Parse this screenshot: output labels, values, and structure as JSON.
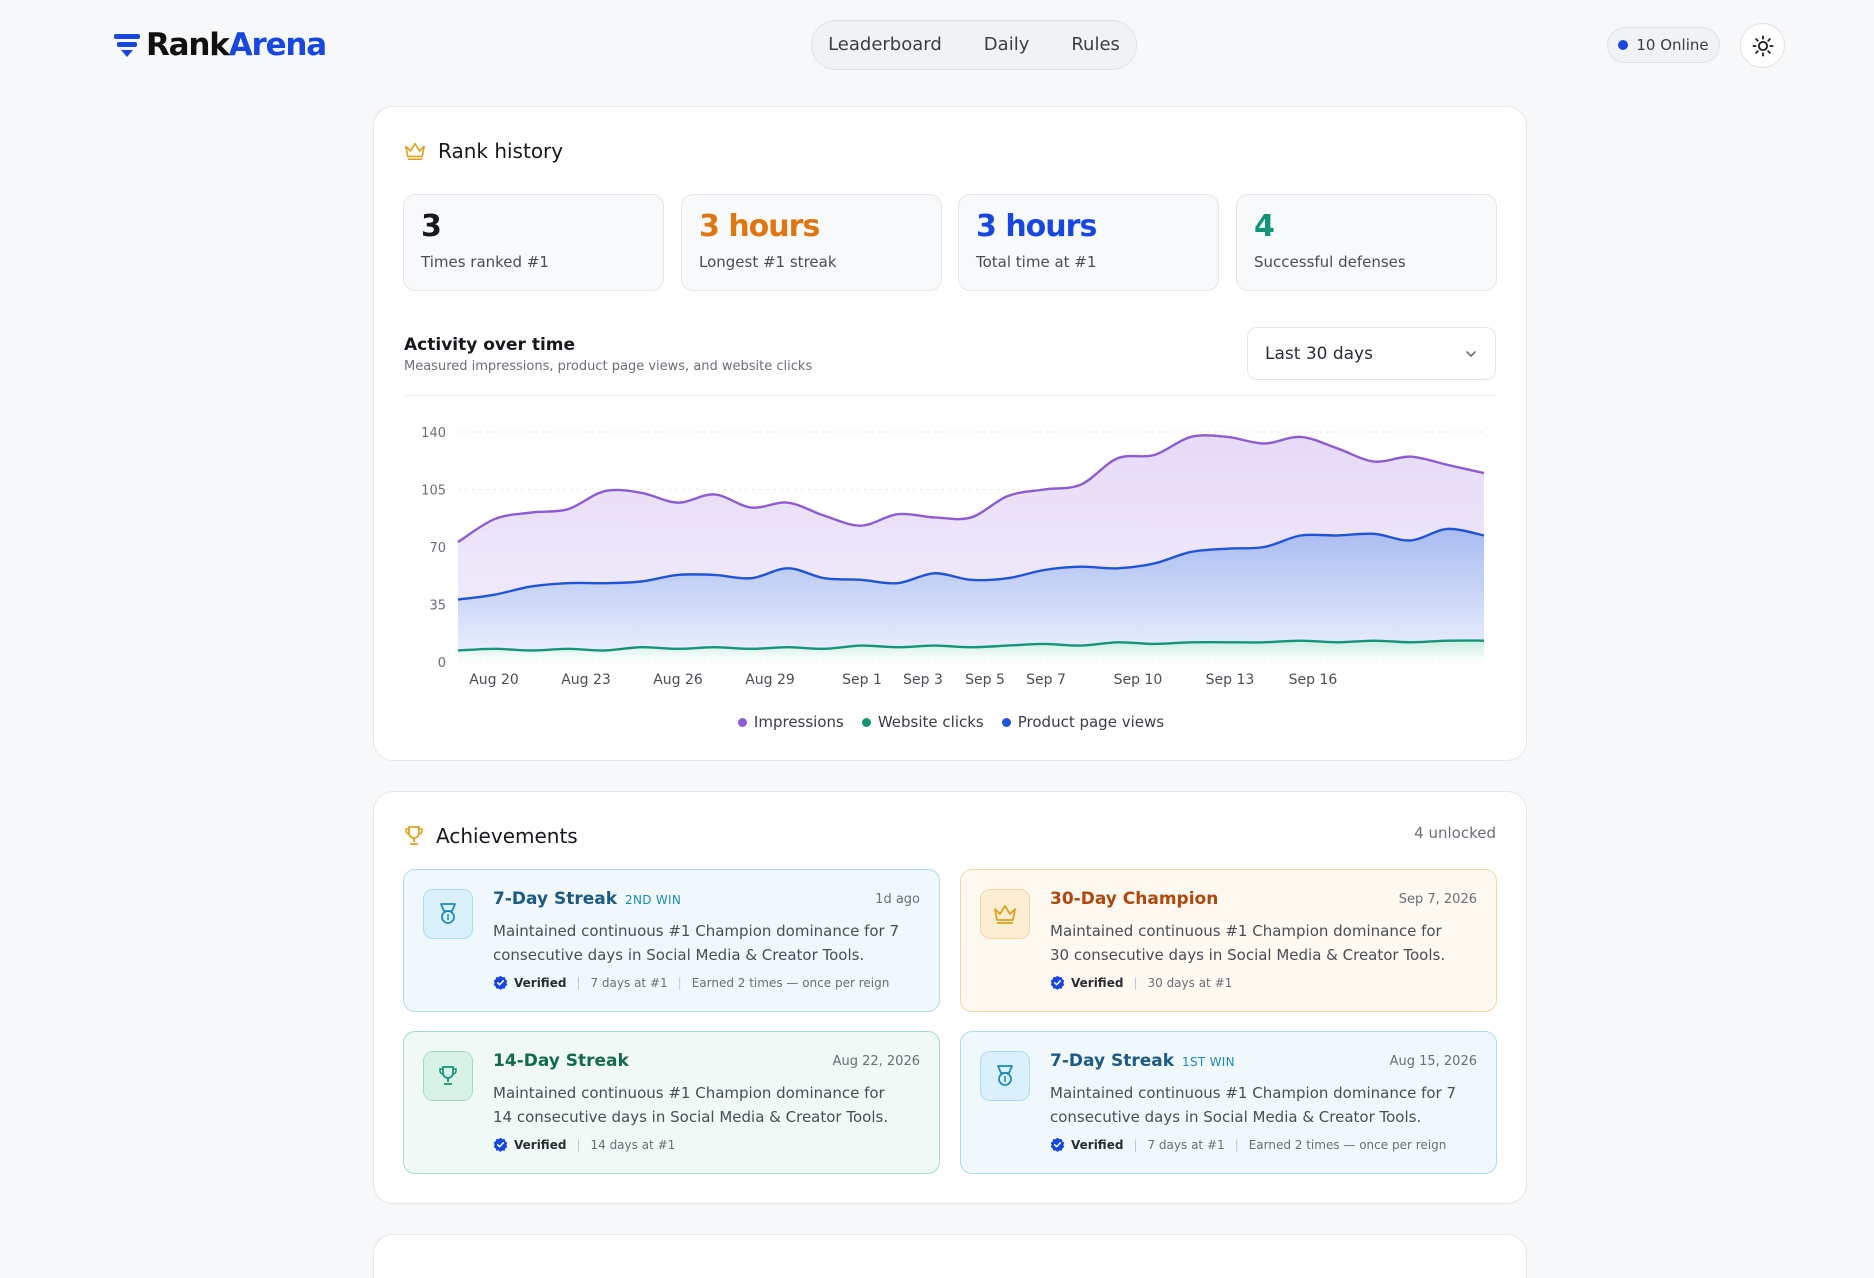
{
  "header": {
    "brand_part1": "Rank",
    "brand_part2": "Arena",
    "nav": [
      "Leaderboard",
      "Daily",
      "Rules"
    ],
    "online": "10 Online"
  },
  "rank_history": {
    "title": "Rank history",
    "stats": [
      {
        "value": "3",
        "label": "Times ranked #1",
        "color": "#16181d"
      },
      {
        "value": "3 hours",
        "label": "Longest #1 streak",
        "color": "#e07611"
      },
      {
        "value": "3 hours",
        "label": "Total time at #1",
        "color": "#1746e0"
      },
      {
        "value": "4",
        "label": "Successful defenses",
        "color": "#11957a"
      }
    ],
    "activity_title": "Activity over time",
    "activity_subtitle": "Measured impressions, product page views, and website clicks",
    "range_selected": "Last 30 days"
  },
  "chart_data": {
    "type": "area",
    "x_tick_labels": [
      "Aug 20",
      "Aug 23",
      "Aug 26",
      "Aug 29",
      "Sep 1",
      "Sep 3",
      "Sep 5",
      "Sep 7",
      "Sep 10",
      "Sep 13",
      "Sep 16"
    ],
    "y_ticks": [
      0,
      35,
      70,
      105,
      140
    ],
    "ylim": [
      0,
      140
    ],
    "grid": "horizontal dashed",
    "legend_position": "bottom-center",
    "series": [
      {
        "name": "Impressions",
        "color": "#8e5bd4",
        "fill": "#ece3f8",
        "values": [
          73,
          87,
          91,
          93,
          104,
          103,
          97,
          102,
          94,
          97,
          89,
          83,
          90,
          88,
          88,
          101,
          105,
          108,
          124,
          126,
          137,
          137,
          133,
          137,
          130,
          122,
          125,
          120,
          115
        ]
      },
      {
        "name": "Product page views",
        "color": "#1f54d8",
        "fill": "#c6d2f6",
        "values": [
          38,
          41,
          46,
          48,
          48,
          49,
          53,
          53,
          51,
          57,
          51,
          50,
          48,
          54,
          50,
          51,
          56,
          58,
          57,
          60,
          67,
          69,
          70,
          77,
          77,
          78,
          74,
          81,
          77
        ]
      },
      {
        "name": "Website clicks",
        "color": "#14957a",
        "fill": "#daf1ea",
        "values": [
          7,
          8,
          7,
          8,
          7,
          9,
          8,
          9,
          8,
          9,
          8,
          10,
          9,
          10,
          9,
          10,
          11,
          10,
          12,
          11,
          12,
          12,
          12,
          13,
          12,
          13,
          12,
          13,
          13
        ]
      }
    ]
  },
  "achievements": {
    "title": "Achievements",
    "unlocked": "4 unlocked",
    "items": [
      {
        "title": "7-Day Streak",
        "badge": "2ND WIN",
        "date": "1d ago",
        "desc": "Maintained continuous #1 Champion dominance for 7 consecutive days in Social Media & Creator Tools.",
        "verified": "Verified",
        "days": "7 days at #1",
        "extra": "Earned 2 times — once per reign",
        "theme": "blue",
        "icon": "medal-icon"
      },
      {
        "title": "30-Day Champion",
        "badge": "",
        "date": "Sep 7, 2026",
        "desc": "Maintained continuous #1 Champion dominance for 30 consecutive days in Social Media & Creator Tools.",
        "verified": "Verified",
        "days": "30 days at #1",
        "extra": "",
        "theme": "gold",
        "icon": "crown-icon"
      },
      {
        "title": "14-Day Streak",
        "badge": "",
        "date": "Aug 22, 2026",
        "desc": "Maintained continuous #1 Champion dominance for 14 consecutive days in Social Media & Creator Tools.",
        "verified": "Verified",
        "days": "14 days at #1",
        "extra": "",
        "theme": "green",
        "icon": "trophy-icon"
      },
      {
        "title": "7-Day Streak",
        "badge": "1ST WIN",
        "date": "Aug 15, 2026",
        "desc": "Maintained continuous #1 Champion dominance for 7 consecutive days in Social Media & Creator Tools.",
        "verified": "Verified",
        "days": "7 days at #1",
        "extra": "Earned 2 times — once per reign",
        "theme": "blue",
        "icon": "medal-icon"
      }
    ]
  }
}
